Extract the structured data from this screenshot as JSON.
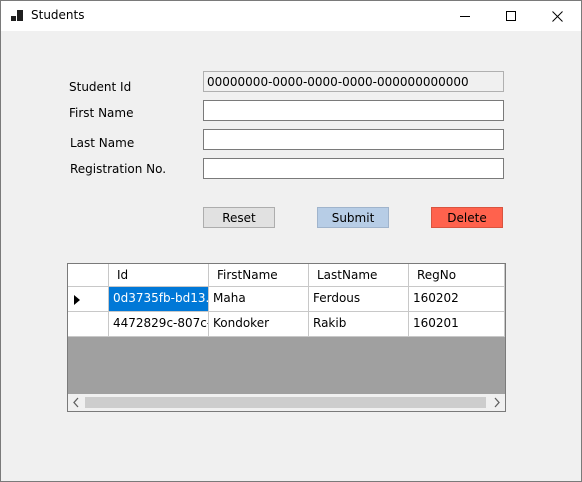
{
  "window": {
    "title": "Students"
  },
  "form": {
    "student_id_label": "Student Id",
    "first_name_label": "First Name",
    "last_name_label": "Last Name",
    "reg_no_label": "Registration No.",
    "student_id_value": "00000000-0000-0000-0000-000000000000",
    "first_name_value": "",
    "last_name_value": "",
    "reg_no_value": ""
  },
  "buttons": {
    "reset": "Reset",
    "submit": "Submit",
    "delete": "Delete"
  },
  "grid": {
    "columns": [
      "Id",
      "FirstName",
      "LastName",
      "RegNo"
    ],
    "rows": [
      {
        "id": "0d3735fb-bd13...",
        "first": "Maha",
        "last": "Ferdous",
        "reg": "160202"
      },
      {
        "id": "4472829c-807c-...",
        "first": "Kondoker",
        "last": "Rakib",
        "reg": "160201"
      }
    ]
  },
  "colors": {
    "submit": "#b7cde6",
    "delete": "#ff624d",
    "selected": "#0078d7"
  }
}
